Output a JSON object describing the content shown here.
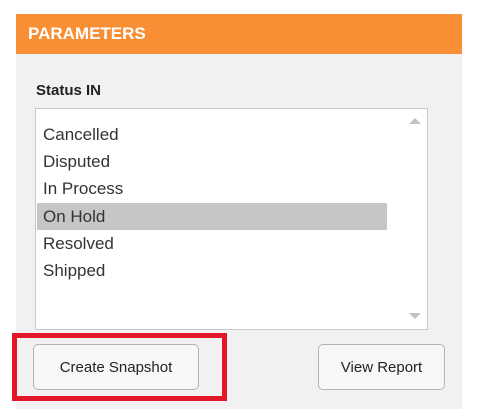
{
  "panel": {
    "title": "PARAMETERS",
    "header_color": "#f98f35",
    "background_color": "#f1f1f1"
  },
  "status_filter": {
    "label": "Status IN",
    "options": [
      {
        "label": "Cancelled",
        "selected": false
      },
      {
        "label": "Disputed",
        "selected": false
      },
      {
        "label": "In Process",
        "selected": false
      },
      {
        "label": "On Hold",
        "selected": true
      },
      {
        "label": "Resolved",
        "selected": false
      },
      {
        "label": "Shipped",
        "selected": false
      }
    ],
    "scroll_up_icon": "triangle-up-icon",
    "scroll_down_icon": "triangle-down-icon"
  },
  "buttons": {
    "create_snapshot": "Create Snapshot",
    "view_report": "View Report"
  },
  "highlight": {
    "color": "#e2172a",
    "target": "create_snapshot"
  }
}
